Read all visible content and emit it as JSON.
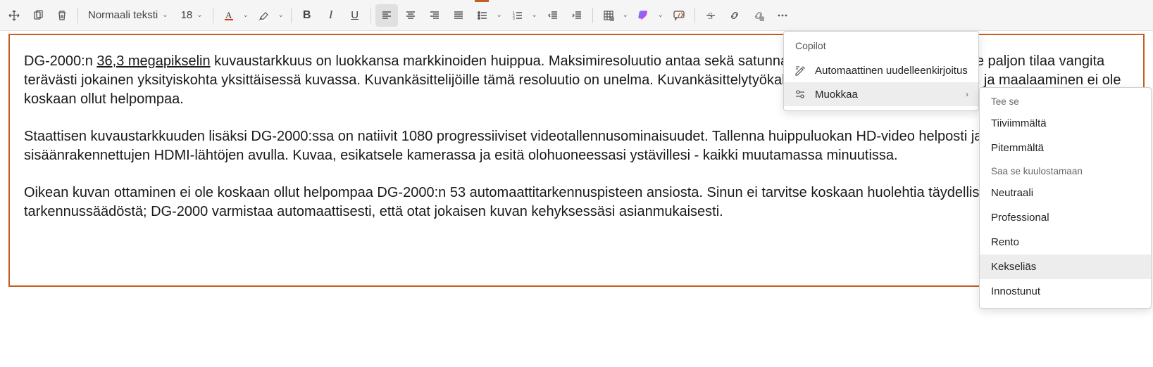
{
  "toolbar": {
    "style_combo": "Normaali teksti",
    "font_size": "18"
  },
  "content": {
    "p1_prefix": "DG-2000:n ",
    "p1_underlined": "36,3 megapikselin",
    "p1_rest": " kuvaustarkkuus on luokkansa markkinoiden huippua. Maksimiresoluutio antaa sekä satunnaisille harrastajille ammattilaisille paljon tilaa vangita terävästi jokainen yksityiskohta yksittäisessä kuvassa. Kuvankäsittelijöille tämä resoluutio on unelma. Kuvankäsittelytyökaluilla zoomaaminen, rajaaminen ja maalaaminen ei ole koskaan ollut helpompaa.",
    "p2": "Staattisen kuvaustarkkuuden lisäksi DG-2000:ssa on natiivit 1080 progressiiviset videotallennusominaisuudet. Tallenna huippuluokan HD-video helposti ja katsele ja lataa niitä sisäänrakennettujen HDMI-lähtöjen avulla. Kuvaa, esikatsele kamerassa ja esitä olohuoneessasi ystävillesi - kaikki muutamassa minuutissa.",
    "p3": "Oikean kuvan ottaminen ei ole koskaan ollut helpompaa DG-2000:n 53 automaattitarkennuspisteen ansiosta. Sinun ei tarvitse koskaan huolehtia täydellisestä tarkennussäädöstä; DG-2000 varmistaa automaattisesti, että otat jokaisen kuvan kehyksessäsi asianmukaisesti."
  },
  "copilot_menu": {
    "title": "Copilot",
    "auto_rewrite": "Automaattinen uudelleenkirjoitus",
    "edit": "Muokkaa"
  },
  "sub_menu": {
    "header1": "Tee se",
    "shorter": "Tiiviimmältä",
    "longer": "Pitemmältä",
    "header2": "Saa se kuulostamaan",
    "neutral": "Neutraali",
    "professional": "Professional",
    "casual": "Rento",
    "inventive": "Kekseliäs",
    "enthusiastic": "Innostunut"
  }
}
